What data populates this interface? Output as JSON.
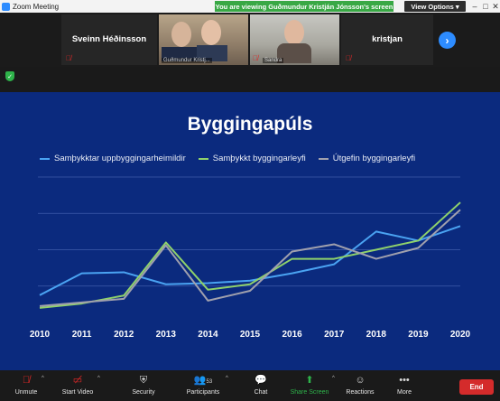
{
  "window": {
    "title": "Zoom Meeting",
    "banner": "You are viewing Guðmundur Kristján Jónsson's screen",
    "view_options": "View Options"
  },
  "participants": [
    {
      "name": "Sveinn Héðinsson",
      "video": false,
      "muted": true
    },
    {
      "name": "Guðmundur Kristj...",
      "video": true,
      "muted": false
    },
    {
      "name": "Sandra",
      "video": true,
      "muted": true
    },
    {
      "name": "kristjan",
      "video": false,
      "muted": true
    }
  ],
  "slide": {
    "title": "Byggingapúls"
  },
  "chart_data": {
    "type": "line",
    "title": "Byggingapúls",
    "x": [
      "2010",
      "2011",
      "2012",
      "2013",
      "2014",
      "2015",
      "2016",
      "2017",
      "2018",
      "2019",
      "2020"
    ],
    "legend_position": "top",
    "grid": true,
    "ylim": [
      0,
      4
    ],
    "series": [
      {
        "name": "Samþykktar uppbyggingarheimildir",
        "color": "#4aa3f2",
        "values": [
          0.75,
          1.35,
          1.38,
          1.05,
          1.08,
          1.15,
          1.35,
          1.6,
          2.5,
          2.25,
          2.65
        ]
      },
      {
        "name": "Samþykkt byggingarleyfi",
        "color": "#8fd16b",
        "values": [
          0.4,
          0.52,
          0.74,
          2.2,
          0.9,
          1.05,
          1.75,
          1.75,
          2.0,
          2.25,
          3.3
        ]
      },
      {
        "name": "Útgefin byggingarleyfi",
        "color": "#a0a0ad",
        "values": [
          0.45,
          0.55,
          0.65,
          2.12,
          0.6,
          0.87,
          1.95,
          2.15,
          1.75,
          2.05,
          3.1
        ]
      }
    ]
  },
  "toolbar": {
    "unmute": "Unmute",
    "start_video": "Start Video",
    "security": "Security",
    "participants": "Participants",
    "participants_count": "53",
    "chat": "Chat",
    "share_screen": "Share Screen",
    "reactions": "Reactions",
    "more": "More",
    "end": "End"
  },
  "colors": {
    "slide_bg": "#0b2a7e",
    "banner": "#39a845",
    "end": "#d42b2b",
    "share": "#2eb34a"
  }
}
